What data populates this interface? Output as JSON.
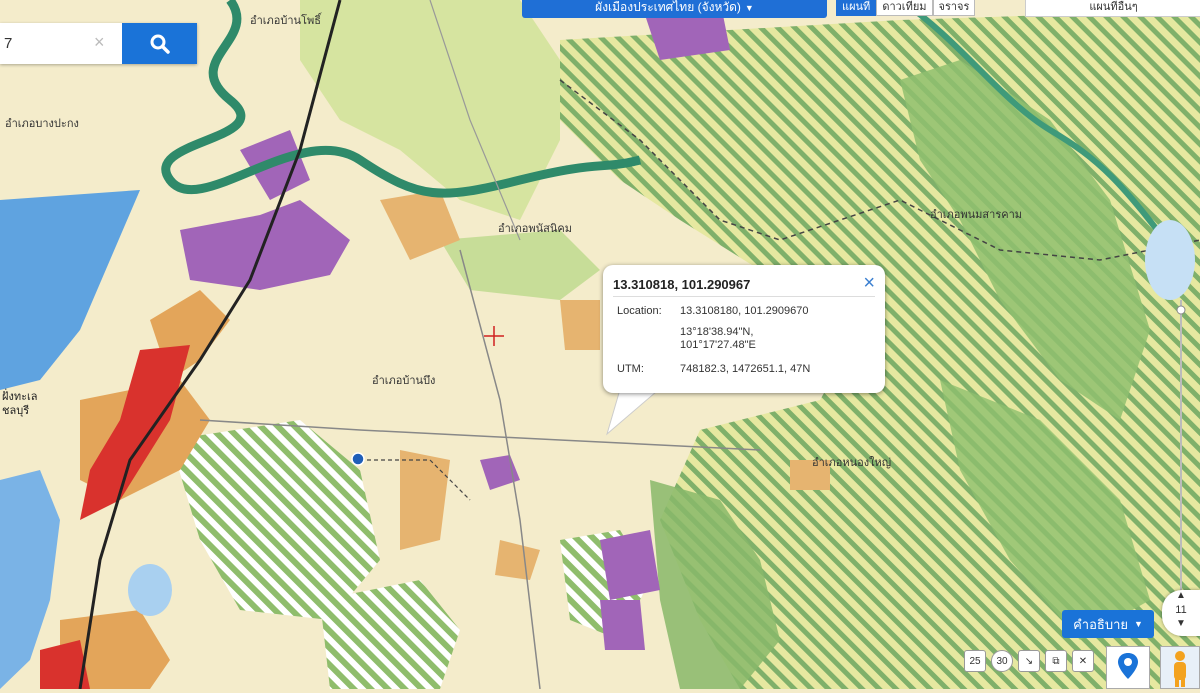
{
  "topbar": {
    "layer_select_label": "ผังเมืองประเทศไทย (จังหวัด)",
    "map_buttons": [
      "แผนที่",
      "ดาวเทียม",
      "จราจร"
    ],
    "right_dropdown_label": "แผนที่อื่นๆ"
  },
  "search": {
    "value": "7",
    "clear_label": "×"
  },
  "map_labels": {
    "district_bang_pakong": "อำเภอบางปะกง",
    "district_ban_pho": "อำเภอบ้านโพธิ์",
    "district_phanom_sarakham": "อำเภอพนมสารคาม",
    "district_phanat_nikhom": "อำเภอพนัสนิคม",
    "district_ban_bueng": "อำเภอบ้านบึง",
    "district_nong_yai": "อำเภอหนองใหญ่",
    "city_chonburi": "ชลบุรี",
    "sea_label": "ฝั่งทะเล"
  },
  "popup": {
    "title": "13.310818, 101.290967",
    "close_label": "×",
    "location_label": "Location:",
    "location_decimal": "13.3108180, 101.2909670",
    "location_dms_lat": "13°18'38.94\"N,",
    "location_dms_lon": "101°17'27.48\"E",
    "utm_label": "UTM:",
    "utm_value": "748182.3, 1472651.1, 47N"
  },
  "legend_button_label": "คำอธิบาย",
  "zoom": {
    "level": "11"
  },
  "tools": [
    "25",
    "30",
    "↘",
    "⧉",
    "✕"
  ],
  "colors": {
    "accent": "#1a73d8",
    "zone_green": "#9cc77a",
    "zone_yellow": "#e8e79a",
    "zone_purple": "#a165b8",
    "zone_red": "#d9322d",
    "zone_orange": "#e3a55a",
    "water": "#5fa3e0",
    "river": "#2f8a6a",
    "base": "#f4eccb"
  }
}
